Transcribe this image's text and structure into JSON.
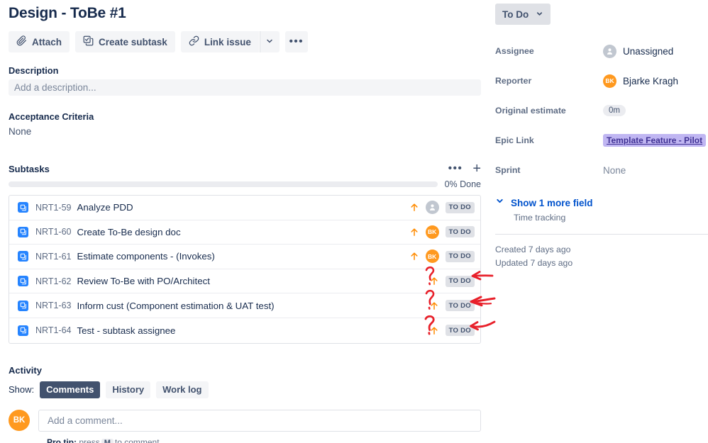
{
  "issue": {
    "title": "Design - ToBe #1",
    "status": "To Do"
  },
  "toolbar": {
    "attach_label": "Attach",
    "create_subtask_label": "Create subtask",
    "link_issue_label": "Link issue",
    "caret_icon": "chevron-down-icon",
    "more_icon": "more-actions-icon"
  },
  "description": {
    "label": "Description",
    "placeholder": "Add a description..."
  },
  "acceptance_criteria": {
    "label": "Acceptance Criteria",
    "value": "None"
  },
  "subtasks": {
    "label": "Subtasks",
    "more_icon": "more-options-icon",
    "add_icon": "plus-icon",
    "progress_percent": 0,
    "progress_label": "0% Done",
    "rows": [
      {
        "key": "NRT1-59",
        "summary": "Analyze PDD",
        "priority": "Medium",
        "assignee_initials": "",
        "assignee_type": "unassigned",
        "status": "TO DO",
        "annotated": false
      },
      {
        "key": "NRT1-60",
        "summary": "Create To-Be design doc",
        "priority": "Medium",
        "assignee_initials": "BK",
        "assignee_type": "bk",
        "status": "TO DO",
        "annotated": false
      },
      {
        "key": "NRT1-61",
        "summary": "Estimate components - (Invokes)",
        "priority": "Medium",
        "assignee_initials": "BK",
        "assignee_type": "bk",
        "status": "TO DO",
        "annotated": false
      },
      {
        "key": "NRT1-62",
        "summary": "Review To-Be with PO/Architect",
        "priority": "Medium",
        "assignee_initials": "",
        "assignee_type": "none",
        "status": "TO DO",
        "annotated": true
      },
      {
        "key": "NRT1-63",
        "summary": "Inform cust (Component estimation & UAT test)",
        "priority": "Medium",
        "assignee_initials": "",
        "assignee_type": "none",
        "status": "TO DO",
        "annotated": true
      },
      {
        "key": "NRT1-64",
        "summary": "Test - subtask assignee",
        "priority": "Medium",
        "assignee_initials": "",
        "assignee_type": "none",
        "status": "TO DO",
        "annotated": true
      }
    ]
  },
  "annotations": {
    "marks": [
      "red-question-mark",
      "red-arrow",
      "red-question-mark",
      "red-arrow",
      "red-question-mark",
      "red-arrow"
    ],
    "color": "#E8202A",
    "note": "hand-drawn markup highlighting missing assignee avatars on three subtasks"
  },
  "activity": {
    "label": "Activity",
    "show_label": "Show:",
    "tabs": [
      {
        "label": "Comments",
        "active": true
      },
      {
        "label": "History",
        "active": false
      },
      {
        "label": "Work log",
        "active": false
      }
    ],
    "comment_avatar_initials": "BK",
    "comment_placeholder": "Add a comment...",
    "pro_tip_prefix": "Pro tip:",
    "pro_tip_mid": "press",
    "pro_tip_key": "M",
    "pro_tip_suffix": "to comment"
  },
  "details": {
    "fields": [
      {
        "label": "Assignee",
        "value": "Unassigned",
        "kind": "avatar-unassigned"
      },
      {
        "label": "Reporter",
        "value": "Bjarke Kragh",
        "kind": "avatar-bk"
      },
      {
        "label": "Original estimate",
        "value": "0m",
        "kind": "pill"
      },
      {
        "label": "Epic Link",
        "value": "Template Feature - Pilot",
        "kind": "epic"
      },
      {
        "label": "Sprint",
        "value": "None",
        "kind": "muted"
      }
    ],
    "show_more_label": "Show 1 more field",
    "show_more_icon": "chevron-down-icon",
    "hidden_field": "Time tracking",
    "created": "Created 7 days ago",
    "updated": "Updated 7 days ago"
  },
  "colors": {
    "brand_blue": "#0052CC",
    "subtask_icon": "#2684FF",
    "priority_orange": "#FF8B00",
    "avatar_orange": "#FF991F",
    "epic_purple": "#C0B6F2",
    "annotation_red": "#E8202A",
    "text_dark": "#172B4D",
    "text_subtle": "#5E6C84"
  }
}
